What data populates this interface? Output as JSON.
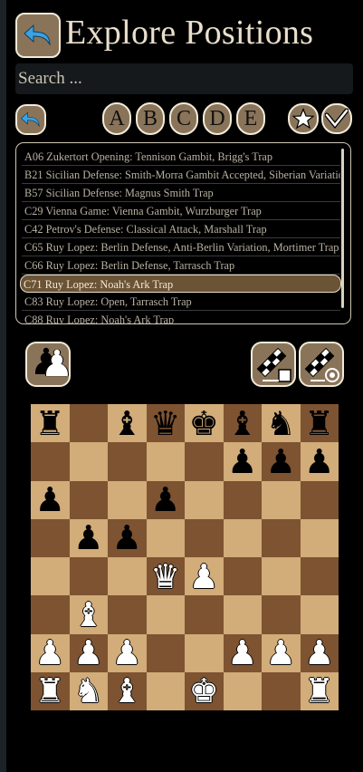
{
  "header": {
    "title": "Explore Positions"
  },
  "search": {
    "placeholder": "Search ..."
  },
  "filters": {
    "letters": [
      "A",
      "B",
      "C",
      "D",
      "E"
    ]
  },
  "openings": [
    {
      "label": "A06 Zukertort Opening: Tennison Gambit, Brigg's Trap",
      "selected": false
    },
    {
      "label": "B21 Sicilian Defense: Smith-Morra Gambit Accepted, Siberian Variatio...",
      "selected": false
    },
    {
      "label": "B57 Sicilian Defense: Magnus Smith Trap",
      "selected": false
    },
    {
      "label": "C29 Vienna Game: Vienna Gambit, Wurzburger Trap",
      "selected": false
    },
    {
      "label": "C42 Petrov's Defense: Classical Attack, Marshall Trap",
      "selected": false
    },
    {
      "label": "C65 Ruy Lopez: Berlin Defense, Anti-Berlin Variation, Mortimer Trap",
      "selected": false
    },
    {
      "label": "C66 Ruy Lopez: Berlin Defense, Tarrasch Trap",
      "selected": false
    },
    {
      "label": "C71 Ruy Lopez: Noah's Ark Trap",
      "selected": true
    },
    {
      "label": "C83 Ruy Lopez: Open, Tarrasch Trap",
      "selected": false
    },
    {
      "label": "C88 Ruy Lopez: Noah's Ark Trap",
      "selected": false
    }
  ],
  "board": {
    "colors": {
      "light": "#d2ac79",
      "dark": "#7d5331"
    },
    "ranks": [
      [
        "bR",
        "",
        "bB",
        "bQ",
        "bK",
        "bB",
        "bN",
        "bR"
      ],
      [
        "",
        "",
        "",
        "",
        "",
        "bP",
        "bP",
        "bP"
      ],
      [
        "bP",
        "",
        "",
        "bP",
        "",
        "",
        "",
        ""
      ],
      [
        "",
        "bP",
        "bP",
        "",
        "",
        "",
        "",
        ""
      ],
      [
        "",
        "",
        "",
        "wQ",
        "wP",
        "",
        "",
        ""
      ],
      [
        "",
        "wB",
        "",
        "",
        "",
        "",
        "",
        ""
      ],
      [
        "wP",
        "wP",
        "wP",
        "",
        "",
        "wP",
        "wP",
        "wP"
      ],
      [
        "wR",
        "wN",
        "wB",
        "",
        "wK",
        "",
        "",
        "wR"
      ]
    ]
  },
  "icons": {
    "back": "back-arrow-icon",
    "star": "star-icon",
    "check": "checkmark-icon",
    "side": "flip-side-icon",
    "export_board": "board-export-icon",
    "analyze_board": "board-analyze-icon"
  },
  "colors": {
    "button_fill": "#8a7459",
    "button_border": "#f1ead8",
    "selected_row": "#6b5336",
    "background": "#000000"
  }
}
